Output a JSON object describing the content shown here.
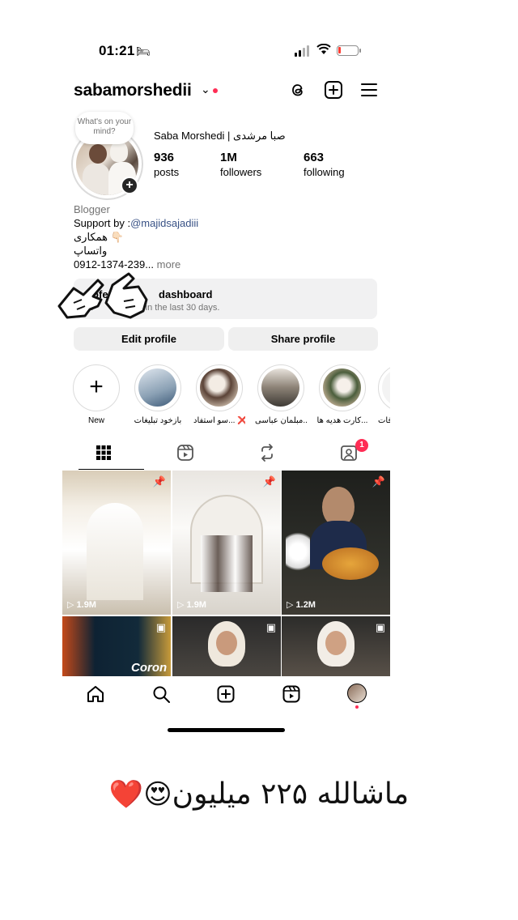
{
  "status_bar": {
    "time": "01:21",
    "sleep_icon": "🛏"
  },
  "header": {
    "username": "sabamorshedii",
    "chevron": "⌄",
    "icons": [
      "threads-icon",
      "create-plus-icon",
      "menu-icon"
    ]
  },
  "profile": {
    "note": "What's on your mind?",
    "display_name": "Saba Morshedi | صبا مرشدی",
    "stats": [
      {
        "num": "936",
        "label": "posts"
      },
      {
        "num": "1M",
        "label": "followers"
      },
      {
        "num": "663",
        "label": "following"
      }
    ]
  },
  "bio": {
    "category": "Blogger",
    "support_prefix": "Support by :",
    "mention": "@majidsajadiii",
    "line2": "همکاری 👇🏻",
    "line3": "واتساپ",
    "phone": "0912-1374-239...",
    "more": " more"
  },
  "dashboard": {
    "title": "Professional dashboard",
    "subtitle": "2 views in the last 30 days.",
    "title_visible": "rofess",
    "title_visible_2": "dashboard",
    "subtitle_visible_1": "2",
    "subtitle_visible_2": "s in the last 30 days."
  },
  "buttons": {
    "edit": "Edit profile",
    "share": "Share profile"
  },
  "highlights": [
    {
      "label": "New"
    },
    {
      "label": "بازخود تبلیغات"
    },
    {
      "label": "سو استفاد... ❌"
    },
    {
      "label": "مبلمان عباسی..."
    },
    {
      "label": "کارت هدیه ها..."
    },
    {
      "label": "فات"
    }
  ],
  "tabs": {
    "notification_count": "1"
  },
  "grid": [
    {
      "views": "1.9M",
      "pinned": true
    },
    {
      "views": "1.9M",
      "pinned": true
    },
    {
      "views": "1.2M",
      "pinned": true
    },
    {
      "views": "",
      "reel": true,
      "overlay_text": "Coron"
    },
    {
      "views": "",
      "reel": true
    },
    {
      "views": "",
      "reel": true
    }
  ],
  "caption": {
    "text": "ماشالله ۲۲۵ میلیون",
    "emoji": "😍❤️"
  },
  "colors": {
    "accent": "#ff2d55",
    "link": "#385185",
    "button_bg": "#efefef"
  }
}
